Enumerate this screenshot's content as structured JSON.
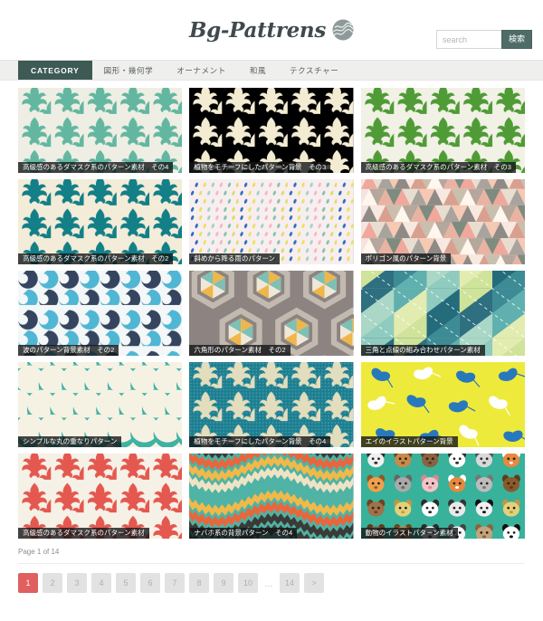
{
  "header": {
    "logo_text": "Bg-Pattrens",
    "logo_icon": "circle-wave-mark-icon",
    "search": {
      "placeholder": "search",
      "value": "",
      "button_label": "検索"
    }
  },
  "nav": {
    "items": [
      {
        "label": "CATEGORY",
        "active": true
      },
      {
        "label": "図形・幾何学",
        "active": false
      },
      {
        "label": "オーナメント",
        "active": false
      },
      {
        "label": "和風",
        "active": false
      },
      {
        "label": "テクスチャー",
        "active": false
      }
    ]
  },
  "grid": {
    "cards": [
      {
        "caption": "高級感のあるダマスク系のパターン素材　その4",
        "pattern": "damask-mint",
        "bg": "#efeee4",
        "fg": "#63b7a0"
      },
      {
        "caption": "植物をモチーフにしたパターン背景　その3",
        "pattern": "damask-gold",
        "bg": "#ceа033",
        "fg": "#f3ecd2"
      },
      {
        "caption": "高級感のあるダマスク系のパターン素材　その3",
        "pattern": "damask-green",
        "bg": "#f2f1e6",
        "fg": "#4f9b36"
      },
      {
        "caption": "高級感のあるダマスク系のパターン素材　その2",
        "pattern": "damask-teal",
        "bg": "#f3ecd8",
        "fg": "#137f87"
      },
      {
        "caption": "斜めから降る雨のパターン",
        "pattern": "rain-dots",
        "bg": "#f8eef0",
        "fg": "#2a6fb5"
      },
      {
        "caption": "ポリゴン風のパターン背景",
        "pattern": "polygon-triangles",
        "bg": "#f4e3e0",
        "fg": "#e8a79c"
      },
      {
        "caption": "波のパターン背景素材　その2",
        "pattern": "waves-blue",
        "bg": "#f4f7f8",
        "fg": "#35455f"
      },
      {
        "caption": "六角形のパターン素材　その2",
        "pattern": "hexagon-gray",
        "bg": "#8d8380",
        "fg": "#f0b64a"
      },
      {
        "caption": "三角と点線の組み合わせパターン素材",
        "pattern": "triangle-dotted",
        "bg": "#3b7f8c",
        "fg": "#c8e08a"
      },
      {
        "caption": "シンプルな丸の重なりパターン",
        "pattern": "scallop-circles",
        "bg": "#f5f2e4",
        "fg": "#3fb2a3"
      },
      {
        "caption": "植物をモチーフにしたパターン背景　その4",
        "pattern": "damask-dotted-teal",
        "bg": "#1b7f93",
        "fg": "#ede3c0"
      },
      {
        "caption": "エイのイラストパターン背景",
        "pattern": "stingray-yellow",
        "bg": "#eeea3c",
        "fg": "#2878bd"
      },
      {
        "caption": "高級感のあるダマスク系のパターン素材",
        "pattern": "damask-red",
        "bg": "#f6f1e6",
        "fg": "#e4584f"
      },
      {
        "caption": "ナバホ系の背景パターン　その4",
        "pattern": "navajo-chevron",
        "bg": "#4fb3a5",
        "fg": "#e9663c"
      },
      {
        "caption": "動物のイラストパターン素材",
        "pattern": "animal-faces",
        "bg": "#38b29b",
        "fg": "#ffffff"
      }
    ]
  },
  "pagination": {
    "page_label": "Page 1 of 14",
    "pages": [
      "1",
      "2",
      "3",
      "4",
      "5",
      "6",
      "7",
      "8",
      "9",
      "10"
    ],
    "ellipsis": "···",
    "last_page": "14",
    "next_label": ">",
    "current": "1",
    "active_color": "#e0605f"
  }
}
